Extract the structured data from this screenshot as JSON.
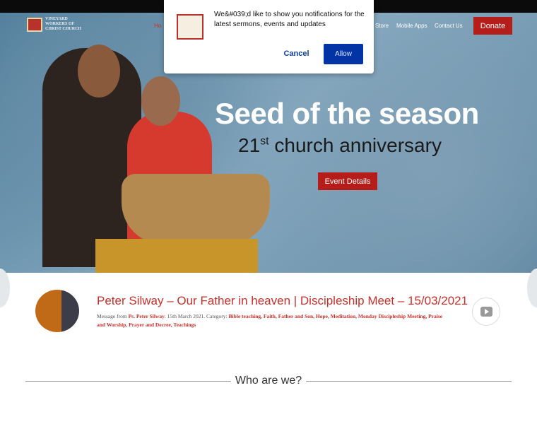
{
  "nav": {
    "logo_text": "VINEYARD WORKERS OF CHRIST CHURCH",
    "items": [
      "Ho",
      "Store",
      "Mobile Apps",
      "Contact Us"
    ],
    "donate": "Donate"
  },
  "hero": {
    "title": "Seed of the season",
    "subtitle_num": "21",
    "subtitle_sup": "st",
    "subtitle_rest": " church anniversary",
    "button": "Event Details"
  },
  "popup": {
    "message": "We&#039;d like to show you notifications for the latest sermons, events and updates",
    "cancel": "Cancel",
    "allow": "Allow"
  },
  "sermon": {
    "title": "Peter Silway – Our Father in heaven | Discipleship Meet – 15/03/2021",
    "meta_prefix": "Message from ",
    "author": "Ps. Peter Silway",
    "date": ". 15th March 2021. Category: ",
    "categories": "Bible teaching, Faith, Father and Son, Hope, Meditation, Monday Discipleship Meeting, Praise and Worship, Prayer and Decree, Teachings",
    "play_icon": "youtube-play-icon"
  },
  "section": {
    "heading": "Who are we?"
  },
  "colors": {
    "accent": "#b51d1a",
    "allow": "#0234a6",
    "title": "#c8302a"
  }
}
